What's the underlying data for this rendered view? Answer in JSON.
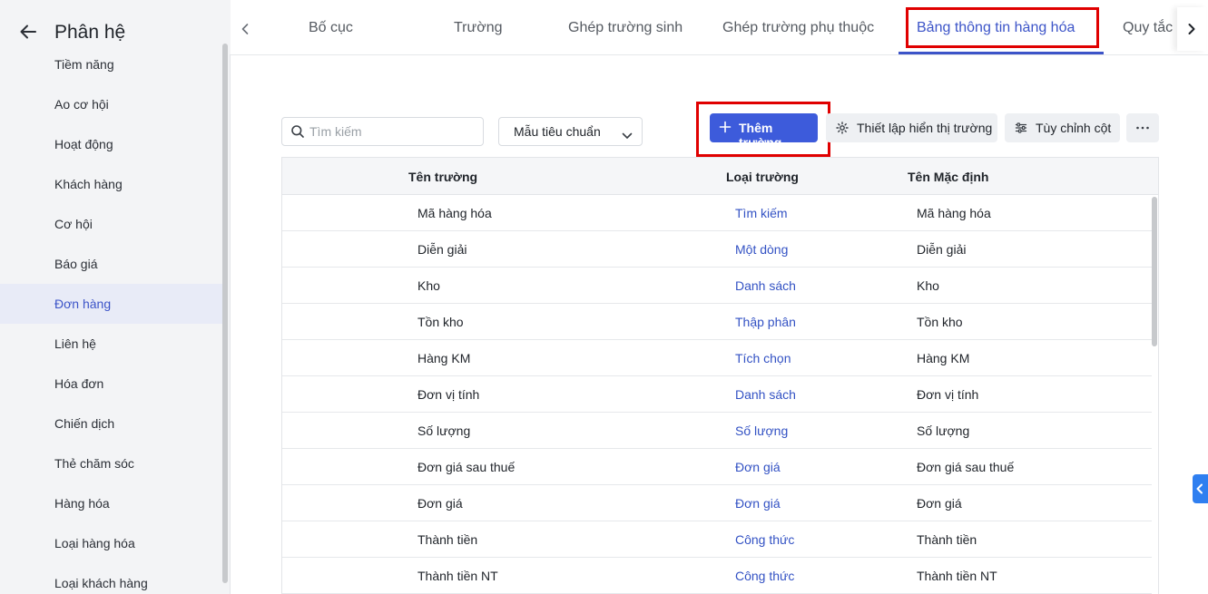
{
  "sidebar": {
    "title": "Phân hệ",
    "items": [
      {
        "label": "Tiềm năng"
      },
      {
        "label": "Ao cơ hội"
      },
      {
        "label": "Hoạt động"
      },
      {
        "label": "Khách hàng"
      },
      {
        "label": "Cơ hội"
      },
      {
        "label": "Báo giá"
      },
      {
        "label": "Đơn hàng",
        "active": true
      },
      {
        "label": "Liên hệ"
      },
      {
        "label": "Hóa đơn"
      },
      {
        "label": "Chiến dịch"
      },
      {
        "label": "Thẻ chăm sóc"
      },
      {
        "label": "Hàng hóa"
      },
      {
        "label": "Loại hàng hóa"
      },
      {
        "label": "Loại khách hàng"
      }
    ]
  },
  "tabs": [
    {
      "label": "Bố cục"
    },
    {
      "label": "Trường"
    },
    {
      "label": "Ghép trường sinh"
    },
    {
      "label": "Ghép trường phụ thuộc"
    },
    {
      "label": "Bảng thông tin hàng hóa",
      "active": true
    },
    {
      "label": "Quy tắc"
    }
  ],
  "toolbar": {
    "search_placeholder": "Tìm kiếm",
    "template_select": "Mẫu tiêu chuẩn",
    "add_field_label": "Thêm trường",
    "display_settings_label": "Thiết lập hiển thị trường",
    "customize_columns_label": "Tùy chỉnh cột"
  },
  "table": {
    "columns": [
      "Tên trường",
      "Loại trường",
      "Tên Mặc định"
    ],
    "rows": [
      [
        "Mã hàng hóa",
        "Tìm kiếm",
        "Mã hàng hóa"
      ],
      [
        "Diễn giải",
        "Một dòng",
        "Diễn giải"
      ],
      [
        "Kho",
        "Danh sách",
        "Kho"
      ],
      [
        "Tồn kho",
        "Thập phân",
        "Tồn kho"
      ],
      [
        "Hàng KM",
        "Tích chọn",
        "Hàng KM"
      ],
      [
        "Đơn vị tính",
        "Danh sách",
        "Đơn vị tính"
      ],
      [
        "Số lượng",
        "Số lượng",
        "Số lượng"
      ],
      [
        "Đơn giá sau thuế",
        "Đơn giá",
        "Đơn giá sau thuế"
      ],
      [
        "Đơn giá",
        "Đơn giá",
        "Đơn giá"
      ],
      [
        "Thành tiền",
        "Công thức",
        "Thành tiền"
      ],
      [
        "Thành tiền NT",
        "Công thức",
        "Thành tiền NT"
      ]
    ]
  },
  "colors": {
    "accent": "#3c54c8",
    "primary_button": "#3d5bdb",
    "highlight_box": "#e00000",
    "field_type_text": "#3352c4"
  }
}
